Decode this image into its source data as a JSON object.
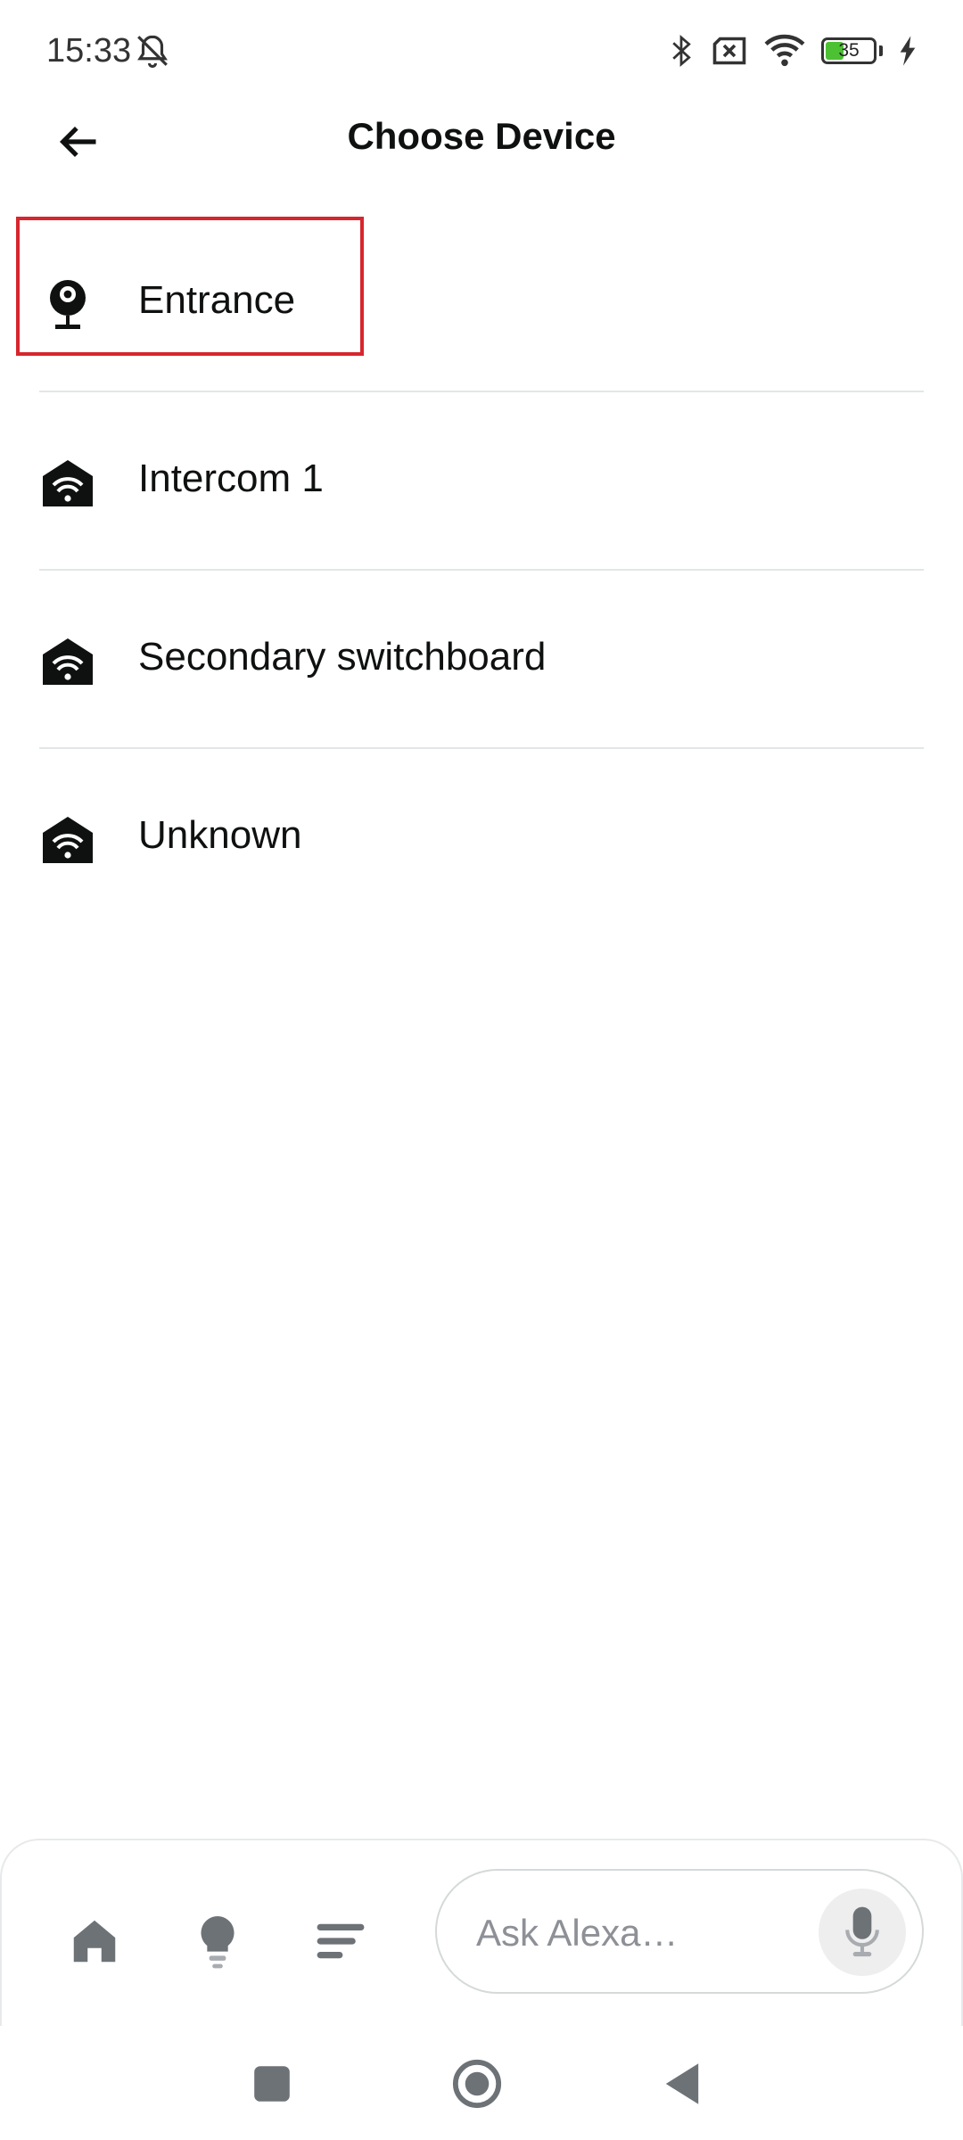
{
  "status_bar": {
    "time": "15:33",
    "battery_level": "35",
    "icons": [
      "bell-muted-icon",
      "bluetooth-icon",
      "sim-disabled-icon",
      "wifi-icon",
      "battery-icon",
      "charging-icon"
    ]
  },
  "header": {
    "title": "Choose Device",
    "back_icon": "arrow-left-icon"
  },
  "devices": [
    {
      "label": "Entrance",
      "icon": "camera-icon",
      "selected": true
    },
    {
      "label": "Intercom 1",
      "icon": "wifi-house-icon"
    },
    {
      "label": "Secondary switchboard",
      "icon": "wifi-house-icon"
    },
    {
      "label": "Unknown",
      "icon": "wifi-house-icon"
    }
  ],
  "bottom_bar": {
    "nav_icons": [
      "home-icon",
      "lightbulb-icon",
      "menu-lines-icon"
    ],
    "ask_placeholder": "Ask Alexa…",
    "mic_icon": "microphone-icon"
  },
  "system_nav": {
    "icons": [
      "recents-icon",
      "home-circle-icon",
      "back-triangle-icon"
    ]
  },
  "colors": {
    "highlight": "#d7262e",
    "text": "#0f1111",
    "divider": "#e3e6e6",
    "muted_icon": "#6d7277"
  }
}
